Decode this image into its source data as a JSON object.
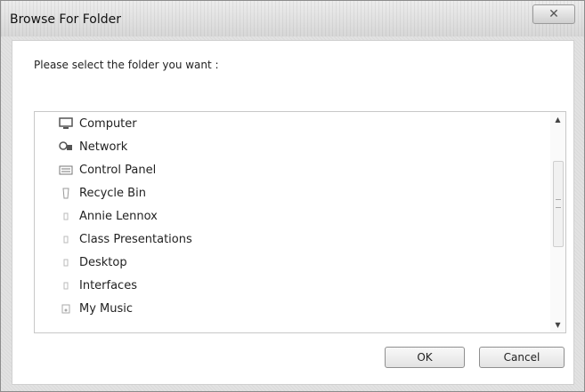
{
  "window": {
    "title": "Browse For Folder",
    "close_label": "✕"
  },
  "prompt": "Please select the folder you want :",
  "tree": {
    "items": [
      {
        "label": "Computer",
        "icon": "computer-icon"
      },
      {
        "label": "Network",
        "icon": "network-icon"
      },
      {
        "label": "Control Panel",
        "icon": "control-panel-icon"
      },
      {
        "label": "Recycle Bin",
        "icon": "recycle-bin-icon"
      },
      {
        "label": "Annie Lennox",
        "icon": "folder-icon"
      },
      {
        "label": "Class Presentations",
        "icon": "folder-icon"
      },
      {
        "label": "Desktop",
        "icon": "folder-icon"
      },
      {
        "label": "Interfaces",
        "icon": "folder-icon"
      },
      {
        "label": "My Music",
        "icon": "music-folder-icon"
      }
    ]
  },
  "scroll": {
    "up_glyph": "▲",
    "down_glyph": "▼"
  },
  "buttons": {
    "ok": "OK",
    "cancel": "Cancel"
  }
}
